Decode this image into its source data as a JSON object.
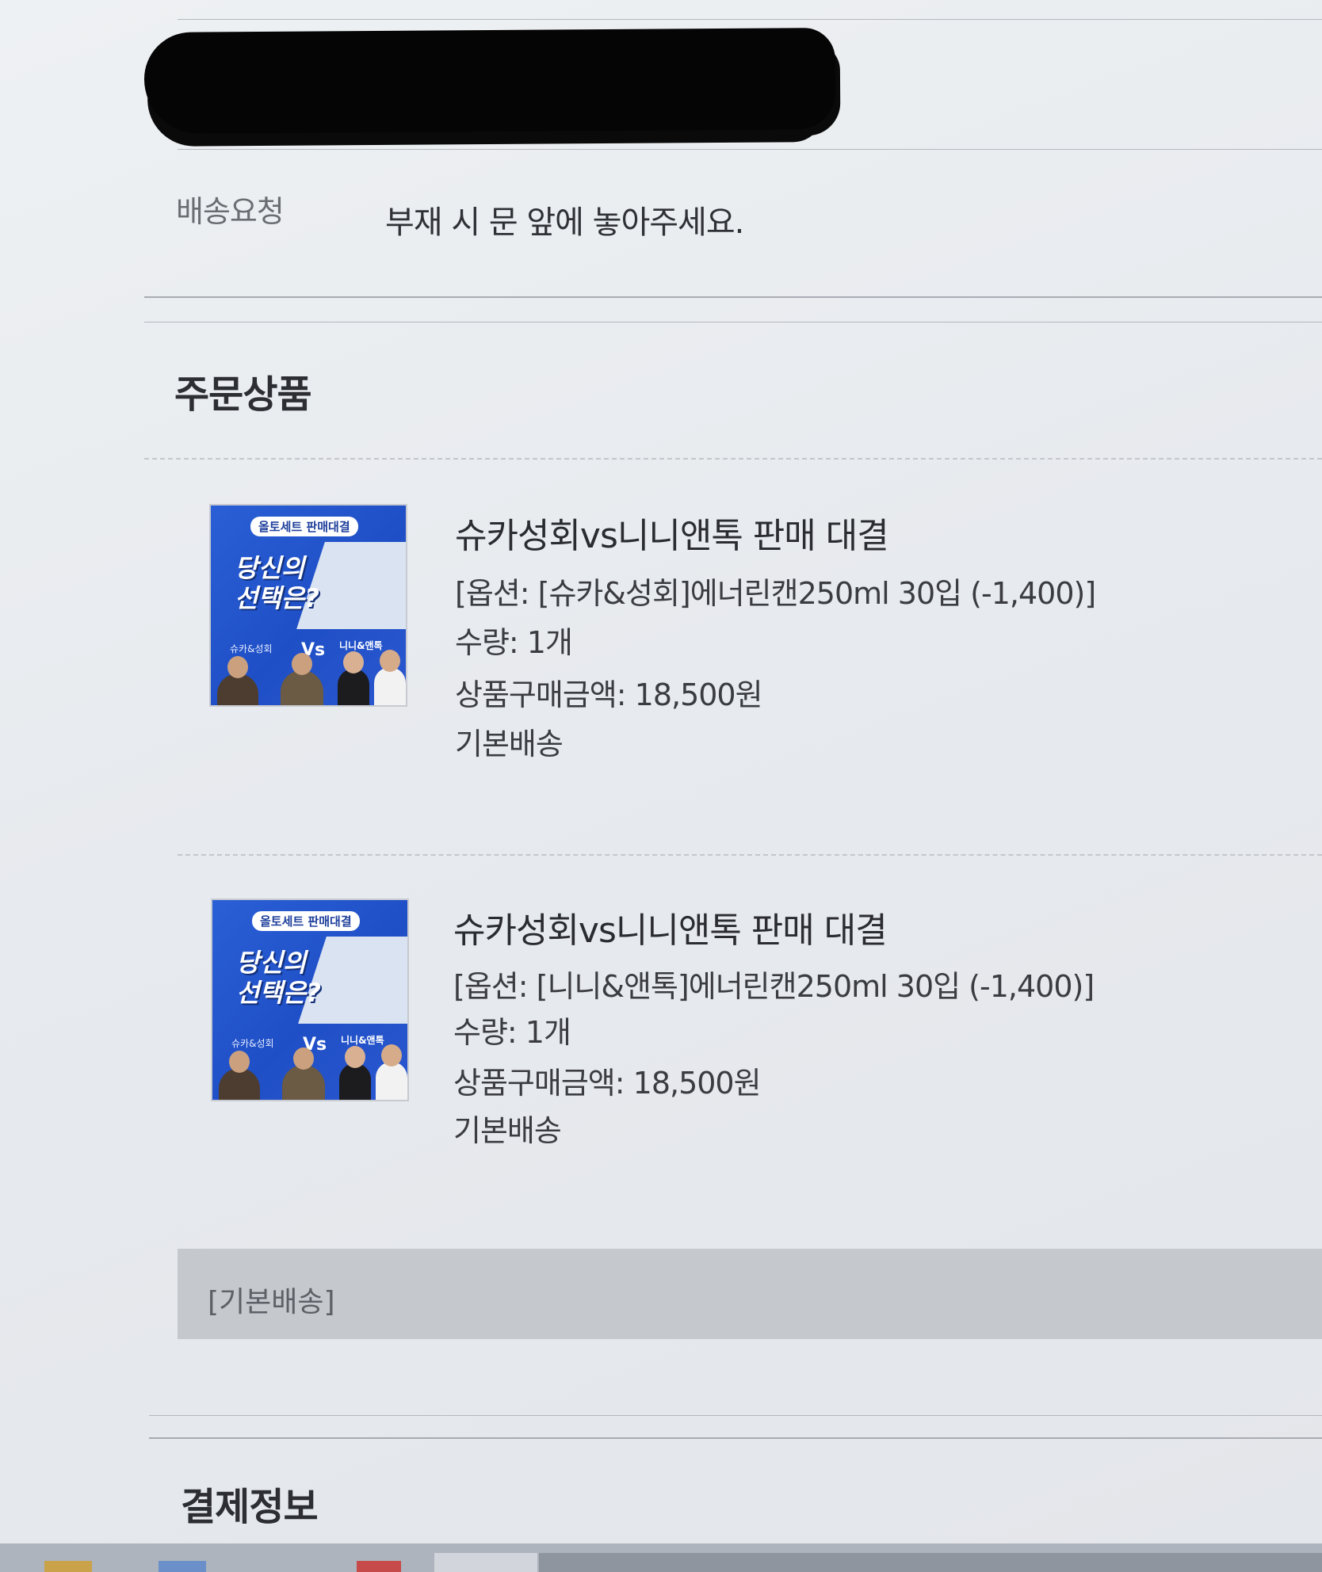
{
  "delivery_request": {
    "label": "배송요청",
    "value": "부재 시 문 앞에 놓아주세요."
  },
  "order_items_section": {
    "title": "주문상품",
    "items": [
      {
        "thumbnail": {
          "tag": "올토세트 판매대결",
          "headline": "당신의\n선택은?",
          "left_name": "슈카&성회",
          "vs": "Vs",
          "right_name": "니니&앤톡"
        },
        "name": "슈카성회vs니니앤톡 판매 대결",
        "option": "[옵션: [슈카&성회]에너린캔250ml 30입 (-1,400)]",
        "quantity": "수량: 1개",
        "price": "상품구매금액: 18,500원",
        "shipping": "기본배송"
      },
      {
        "thumbnail": {
          "tag": "올토세트 판매대결",
          "headline": "당신의\n선택은?",
          "left_name": "슈카&성회",
          "vs": "Vs",
          "right_name": "니니&앤톡"
        },
        "name": "슈카성회vs니니앤톡 판매 대결",
        "option": "[옵션: [니니&앤톡]에너린캔250ml 30입 (-1,400)]",
        "quantity": "수량: 1개",
        "price": "상품구매금액: 18,500원",
        "shipping": "기본배송"
      }
    ],
    "shipping_group_label": "[기본배송]"
  },
  "payment_section": {
    "title": "결제정보"
  },
  "colors": {
    "background": "#e9ecef",
    "thumbnail_blue": "#2455cf",
    "shipping_bar": "#c5c8cd",
    "redaction": "#050505"
  }
}
